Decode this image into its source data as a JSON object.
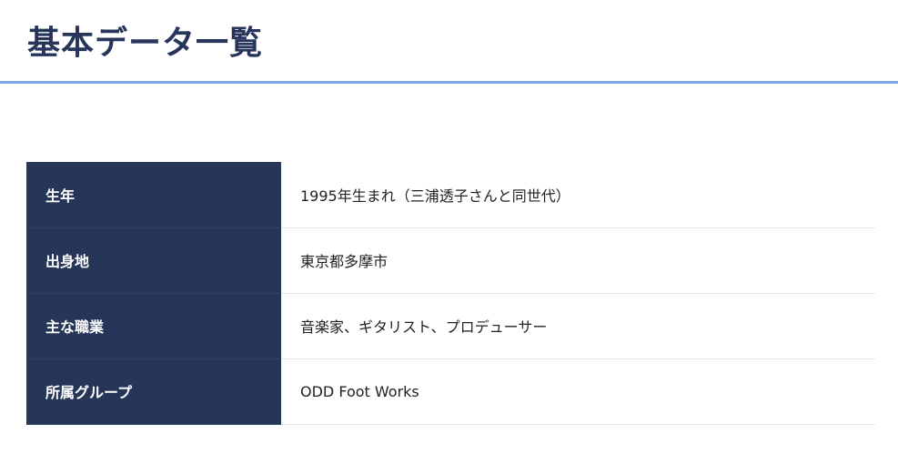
{
  "header": {
    "title": "基本データ一覧"
  },
  "table": {
    "rows": [
      {
        "label": "生年",
        "value": "1995年生まれ（三浦透子さんと同世代）"
      },
      {
        "label": "出身地",
        "value": "東京都多摩市"
      },
      {
        "label": "主な職業",
        "value": "音楽家、ギタリスト、プロデューサー"
      },
      {
        "label": "所属グループ",
        "value": "ODD Foot Works"
      }
    ]
  },
  "colors": {
    "header_underline": "#7fa6e3",
    "title_text": "#263559",
    "label_cell_bg": "#253659",
    "label_cell_text": "#ffffff",
    "row_divider": "#e3e7ee"
  }
}
